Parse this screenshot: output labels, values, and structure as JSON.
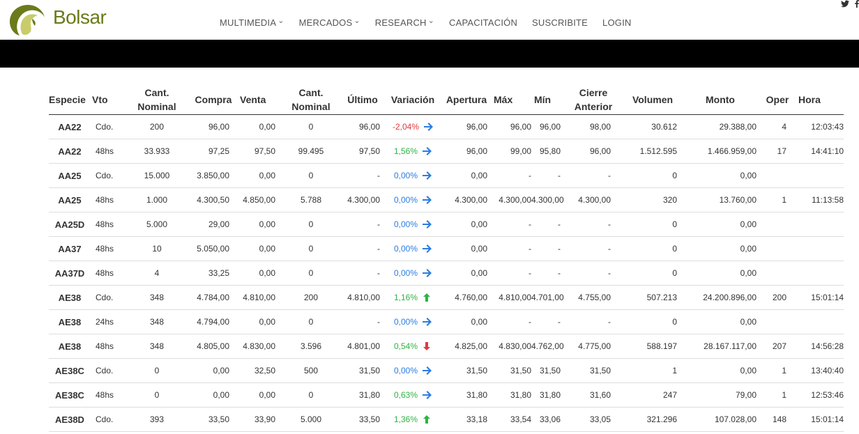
{
  "header": {
    "brand": "Bolsar",
    "nav": [
      {
        "label": "MULTIMEDIA",
        "has_menu": true
      },
      {
        "label": "MERCADOS",
        "has_menu": true
      },
      {
        "label": "RESEARCH",
        "has_menu": true
      },
      {
        "label": "CAPACITACIÓN",
        "has_menu": false
      },
      {
        "label": "SUSCRIBITE",
        "has_menu": false
      },
      {
        "label": "LOGIN",
        "has_menu": false
      }
    ],
    "social": [
      "twitter-icon",
      "facebook-icon"
    ]
  },
  "table": {
    "headers": [
      "Especie",
      "Vto",
      "Cant. Nominal",
      "Compra",
      "Venta",
      "Cant. Nominal",
      "Último",
      "Variación",
      "Apertura",
      "Máx",
      "Mín",
      "Cierre Anterior",
      "Volumen",
      "Monto",
      "Oper",
      "Hora"
    ],
    "rows": [
      {
        "especie": "AA22",
        "vto": "Cdo.",
        "cant_nominal_compra": "200",
        "compra": "96,00",
        "venta": "0,00",
        "cant_nominal_venta": "0",
        "ultimo": "96,00",
        "variacion": "-2,04%",
        "trend": "right",
        "sign": "neg",
        "apertura": "96,00",
        "max": "96,00",
        "min": "96,00",
        "cierre_anterior": "98,00",
        "volumen": "30.612",
        "monto": "29.388,00",
        "oper": "4",
        "hora": "12:03:43"
      },
      {
        "especie": "AA22",
        "vto": "48hs",
        "cant_nominal_compra": "33.933",
        "compra": "97,25",
        "venta": "97,50",
        "cant_nominal_venta": "99.495",
        "ultimo": "97,50",
        "variacion": "1,56%",
        "trend": "right",
        "sign": "pos",
        "apertura": "96,00",
        "max": "99,00",
        "min": "95,80",
        "cierre_anterior": "96,00",
        "volumen": "1.512.595",
        "monto": "1.466.959,00",
        "oper": "17",
        "hora": "14:41:10"
      },
      {
        "especie": "AA25",
        "vto": "Cdo.",
        "cant_nominal_compra": "15.000",
        "compra": "3.850,00",
        "venta": "0,00",
        "cant_nominal_venta": "0",
        "ultimo": "-",
        "variacion": "0,00%",
        "trend": "right",
        "sign": "zero",
        "apertura": "0,00",
        "max": "-",
        "min": "-",
        "cierre_anterior": "-",
        "volumen": "0",
        "monto": "0,00",
        "oper": "",
        "hora": ""
      },
      {
        "especie": "AA25",
        "vto": "48hs",
        "cant_nominal_compra": "1.000",
        "compra": "4.300,50",
        "venta": "4.850,00",
        "cant_nominal_venta": "5.788",
        "ultimo": "4.300,00",
        "variacion": "0,00%",
        "trend": "right",
        "sign": "zero",
        "apertura": "4.300,00",
        "max": "4.300,00",
        "min": "4.300,00",
        "cierre_anterior": "4.300,00",
        "volumen": "320",
        "monto": "13.760,00",
        "oper": "1",
        "hora": "11:13:58"
      },
      {
        "especie": "AA25D",
        "vto": "48hs",
        "cant_nominal_compra": "5.000",
        "compra": "29,00",
        "venta": "0,00",
        "cant_nominal_venta": "0",
        "ultimo": "-",
        "variacion": "0,00%",
        "trend": "right",
        "sign": "zero",
        "apertura": "0,00",
        "max": "-",
        "min": "-",
        "cierre_anterior": "-",
        "volumen": "0",
        "monto": "0,00",
        "oper": "",
        "hora": ""
      },
      {
        "especie": "AA37",
        "vto": "48hs",
        "cant_nominal_compra": "10",
        "compra": "5.050,00",
        "venta": "0,00",
        "cant_nominal_venta": "0",
        "ultimo": "-",
        "variacion": "0,00%",
        "trend": "right",
        "sign": "zero",
        "apertura": "0,00",
        "max": "-",
        "min": "-",
        "cierre_anterior": "-",
        "volumen": "0",
        "monto": "0,00",
        "oper": "",
        "hora": ""
      },
      {
        "especie": "AA37D",
        "vto": "48hs",
        "cant_nominal_compra": "4",
        "compra": "33,25",
        "venta": "0,00",
        "cant_nominal_venta": "0",
        "ultimo": "-",
        "variacion": "0,00%",
        "trend": "right",
        "sign": "zero",
        "apertura": "0,00",
        "max": "-",
        "min": "-",
        "cierre_anterior": "-",
        "volumen": "0",
        "monto": "0,00",
        "oper": "",
        "hora": ""
      },
      {
        "especie": "AE38",
        "vto": "Cdo.",
        "cant_nominal_compra": "348",
        "compra": "4.784,00",
        "venta": "4.810,00",
        "cant_nominal_venta": "200",
        "ultimo": "4.810,00",
        "variacion": "1,16%",
        "trend": "up",
        "sign": "pos",
        "apertura": "4.760,00",
        "max": "4.810,00",
        "min": "4.701,00",
        "cierre_anterior": "4.755,00",
        "volumen": "507.213",
        "monto": "24.200.896,00",
        "oper": "200",
        "hora": "15:01:14"
      },
      {
        "especie": "AE38",
        "vto": "24hs",
        "cant_nominal_compra": "348",
        "compra": "4.794,00",
        "venta": "0,00",
        "cant_nominal_venta": "0",
        "ultimo": "-",
        "variacion": "0,00%",
        "trend": "right",
        "sign": "zero",
        "apertura": "0,00",
        "max": "-",
        "min": "-",
        "cierre_anterior": "-",
        "volumen": "0",
        "monto": "0,00",
        "oper": "",
        "hora": ""
      },
      {
        "especie": "AE38",
        "vto": "48hs",
        "cant_nominal_compra": "348",
        "compra": "4.805,00",
        "venta": "4.830,00",
        "cant_nominal_venta": "3.596",
        "ultimo": "4.801,00",
        "variacion": "0,54%",
        "trend": "down",
        "sign": "pos",
        "apertura": "4.825,00",
        "max": "4.830,00",
        "min": "4.762,00",
        "cierre_anterior": "4.775,00",
        "volumen": "588.197",
        "monto": "28.167.117,00",
        "oper": "207",
        "hora": "14:56:28"
      },
      {
        "especie": "AE38C",
        "vto": "Cdo.",
        "cant_nominal_compra": "0",
        "compra": "0,00",
        "venta": "32,50",
        "cant_nominal_venta": "500",
        "ultimo": "31,50",
        "variacion": "0,00%",
        "trend": "right",
        "sign": "zero",
        "apertura": "31,50",
        "max": "31,50",
        "min": "31,50",
        "cierre_anterior": "31,50",
        "volumen": "1",
        "monto": "0,00",
        "oper": "1",
        "hora": "13:40:40"
      },
      {
        "especie": "AE38C",
        "vto": "48hs",
        "cant_nominal_compra": "0",
        "compra": "0,00",
        "venta": "0,00",
        "cant_nominal_venta": "0",
        "ultimo": "31,80",
        "variacion": "0,63%",
        "trend": "right",
        "sign": "pos",
        "apertura": "31,80",
        "max": "31,80",
        "min": "31,80",
        "cierre_anterior": "31,60",
        "volumen": "247",
        "monto": "79,00",
        "oper": "1",
        "hora": "12:53:46"
      },
      {
        "especie": "AE38D",
        "vto": "Cdo.",
        "cant_nominal_compra": "393",
        "compra": "33,50",
        "venta": "33,90",
        "cant_nominal_venta": "5.000",
        "ultimo": "33,50",
        "variacion": "1,36%",
        "trend": "up",
        "sign": "pos",
        "apertura": "33,18",
        "max": "33,54",
        "min": "33,06",
        "cierre_anterior": "33,05",
        "volumen": "321.296",
        "monto": "107.028,00",
        "oper": "148",
        "hora": "15:01:14"
      }
    ]
  },
  "colors": {
    "brand": "#6b7a1a",
    "negative": "#e0393e",
    "positive": "#2fb344",
    "neutral": "#2a7de1",
    "arrow_right": "#2a7de1",
    "arrow_up": "#2fb344",
    "arrow_down": "#e0393e"
  }
}
